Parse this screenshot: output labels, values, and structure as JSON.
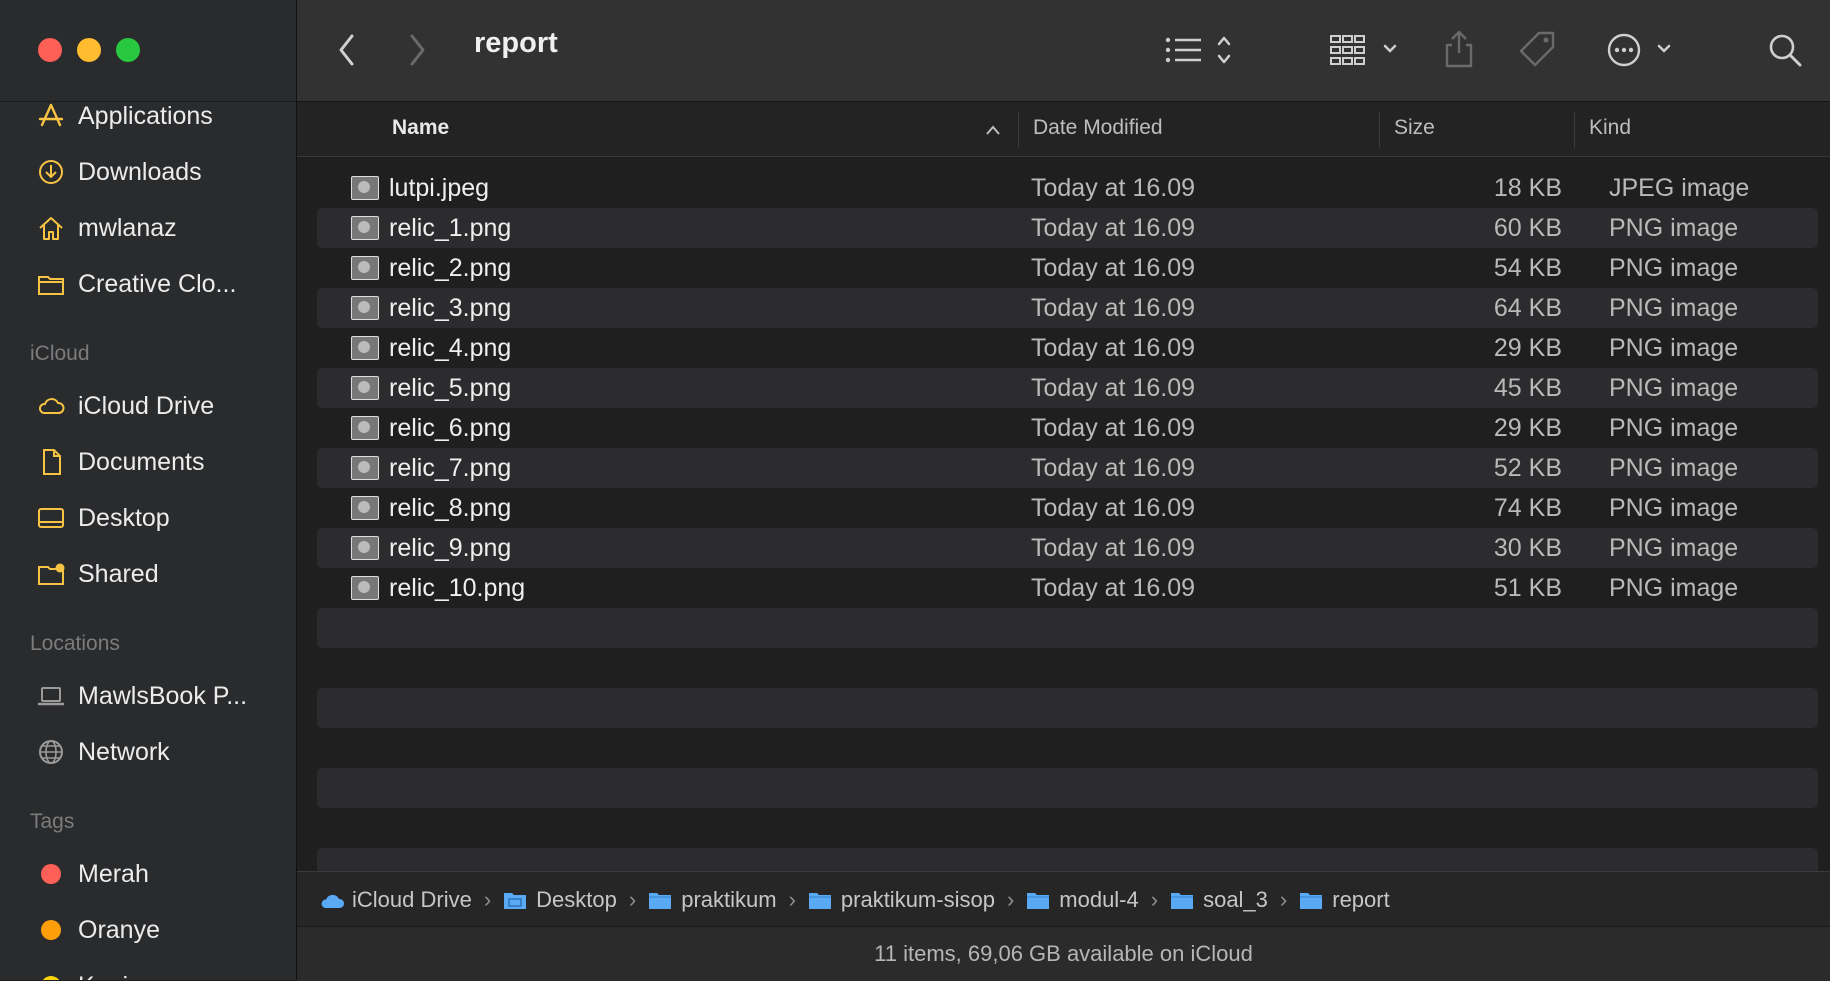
{
  "window": {
    "title": "report",
    "traffic_lights": {
      "close": "#fe5f57",
      "minimize": "#febc2e",
      "zoom": "#28c840"
    }
  },
  "toolbar": {
    "back_icon": "chevron-left-icon",
    "forward_icon": "chevron-right-icon",
    "view_icon": "list-view-icon",
    "group_icon": "grid-group-icon",
    "share_icon": "share-icon",
    "tag_icon": "tag-icon",
    "action_icon": "ellipsis-circle-icon",
    "search_icon": "search-icon"
  },
  "sidebar": {
    "favorites": [
      {
        "label": "Applications",
        "icon": "applications-icon"
      },
      {
        "label": "Downloads",
        "icon": "download-icon"
      },
      {
        "label": "mwlanaz",
        "icon": "home-icon"
      },
      {
        "label": "Creative Clo...",
        "icon": "folder-icon"
      }
    ],
    "icloud_header": "iCloud",
    "icloud": [
      {
        "label": "iCloud Drive",
        "icon": "cloud-icon"
      },
      {
        "label": "Documents",
        "icon": "document-icon"
      },
      {
        "label": "Desktop",
        "icon": "desktop-icon"
      },
      {
        "label": "Shared",
        "icon": "shared-folder-icon"
      }
    ],
    "locations_header": "Locations",
    "locations": [
      {
        "label": "MawlsBook P...",
        "icon": "laptop-icon"
      },
      {
        "label": "Network",
        "icon": "globe-icon"
      }
    ],
    "tags_header": "Tags",
    "tags": [
      {
        "label": "Merah",
        "color": "#fe5f57"
      },
      {
        "label": "Oranye",
        "color": "#fe9f0a"
      },
      {
        "label": "Kuning",
        "color": "#fed60a"
      }
    ],
    "accent_color": "#f6c344"
  },
  "columns": {
    "name": "Name",
    "date": "Date Modified",
    "size": "Size",
    "kind": "Kind"
  },
  "files": [
    {
      "name": "lutpi.jpeg",
      "date": "Today at 16.09",
      "size": "18 KB",
      "kind": "JPEG image"
    },
    {
      "name": "relic_1.png",
      "date": "Today at 16.09",
      "size": "60 KB",
      "kind": "PNG image"
    },
    {
      "name": "relic_2.png",
      "date": "Today at 16.09",
      "size": "54 KB",
      "kind": "PNG image"
    },
    {
      "name": "relic_3.png",
      "date": "Today at 16.09",
      "size": "64 KB",
      "kind": "PNG image"
    },
    {
      "name": "relic_4.png",
      "date": "Today at 16.09",
      "size": "29 KB",
      "kind": "PNG image"
    },
    {
      "name": "relic_5.png",
      "date": "Today at 16.09",
      "size": "45 KB",
      "kind": "PNG image"
    },
    {
      "name": "relic_6.png",
      "date": "Today at 16.09",
      "size": "29 KB",
      "kind": "PNG image"
    },
    {
      "name": "relic_7.png",
      "date": "Today at 16.09",
      "size": "52 KB",
      "kind": "PNG image"
    },
    {
      "name": "relic_8.png",
      "date": "Today at 16.09",
      "size": "74 KB",
      "kind": "PNG image"
    },
    {
      "name": "relic_9.png",
      "date": "Today at 16.09",
      "size": "30 KB",
      "kind": "PNG image"
    },
    {
      "name": "relic_10.png",
      "date": "Today at 16.09",
      "size": "51 KB",
      "kind": "PNG image"
    }
  ],
  "pathbar": [
    {
      "label": "iCloud Drive",
      "icon": "cloud-icon"
    },
    {
      "label": "Desktop",
      "icon": "desktop-folder-icon"
    },
    {
      "label": "praktikum",
      "icon": "folder-icon"
    },
    {
      "label": "praktikum-sisop",
      "icon": "folder-icon"
    },
    {
      "label": "modul-4",
      "icon": "folder-icon"
    },
    {
      "label": "soal_3",
      "icon": "folder-icon"
    },
    {
      "label": "report",
      "icon": "folder-icon"
    }
  ],
  "status": "11 items, 69,06 GB available on iCloud"
}
